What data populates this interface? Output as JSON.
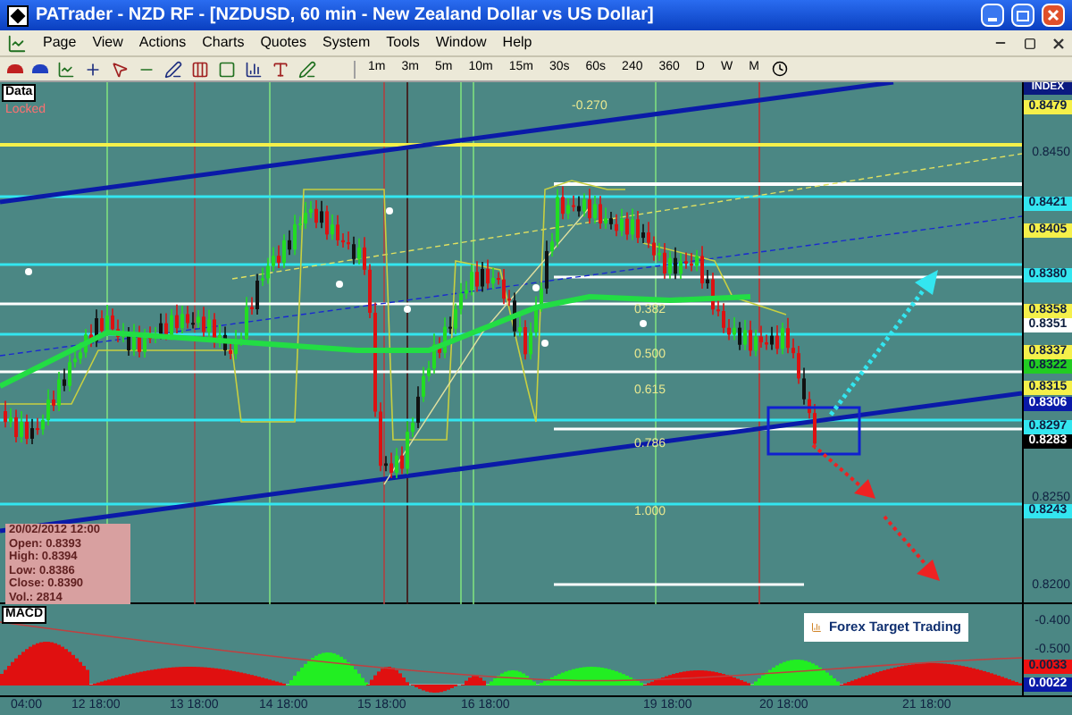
{
  "window": {
    "title": "PATrader - NZD RF - [NZDUSD, 60 min - New Zealand Dollar vs US Dollar]"
  },
  "menu": [
    "Page",
    "View",
    "Actions",
    "Charts",
    "Quotes",
    "System",
    "Tools",
    "Window",
    "Help"
  ],
  "timeframes": [
    "1m",
    "3m",
    "5m",
    "10m",
    "15m",
    "30s",
    "60s",
    "240",
    "360",
    "D",
    "W",
    "M"
  ],
  "chart": {
    "panel_label": "Data",
    "status": "Locked",
    "axis_header": "INDEX",
    "price_labels": [
      {
        "text": "0.8479",
        "kind": "tag",
        "color": "#f5f04a"
      },
      {
        "text": "0.8450",
        "kind": "tick"
      },
      {
        "text": "0.8421",
        "kind": "tag",
        "color": "#33e6f0"
      },
      {
        "text": "0.8405",
        "kind": "tag",
        "color": "#f5f04a"
      },
      {
        "text": "0.8380",
        "kind": "tag",
        "color": "#33e6f0"
      },
      {
        "text": "0.8358",
        "kind": "tag",
        "color": "#f5f04a"
      },
      {
        "text": "0.8351",
        "kind": "tag",
        "color": "#ffffff"
      },
      {
        "text": "0.8337",
        "kind": "tag",
        "color": "#f5f04a"
      },
      {
        "text": "0.8322",
        "kind": "tag",
        "color": "#22cc22"
      },
      {
        "text": "0.8315",
        "kind": "tag",
        "color": "#f5f04a"
      },
      {
        "text": "0.8306",
        "kind": "tag",
        "color": "#0a1aa8"
      },
      {
        "text": "0.8297",
        "kind": "tag",
        "color": "#33e6f0"
      },
      {
        "text": "0.8283",
        "kind": "tag",
        "color": "#000000"
      },
      {
        "text": "0.8250",
        "kind": "tick"
      },
      {
        "text": "0.8243",
        "kind": "tag",
        "color": "#33e6f0"
      },
      {
        "text": "0.8200",
        "kind": "tick"
      }
    ],
    "fib_levels": [
      "-0.270",
      "0.382",
      "0.500",
      "0.615",
      "0.786",
      "1.000"
    ],
    "info_box": {
      "datetime": "20/02/2012 12:00",
      "lines": [
        "Open: 0.8393",
        "High: 0.8394",
        "Low: 0.8386",
        "Close: 0.8390",
        "Vol.: 2814"
      ]
    },
    "logo": "Forex Target Trading"
  },
  "macd": {
    "label": "MACD",
    "axis_labels": [
      {
        "text": "-0.400",
        "kind": "tick"
      },
      {
        "text": "-0.500",
        "kind": "tick"
      },
      {
        "text": "0.0033",
        "kind": "tag",
        "color": "#ee1111"
      },
      {
        "text": "0.0022",
        "kind": "tag",
        "color": "#0a1aa8"
      }
    ]
  },
  "time_axis": [
    "04:00",
    "12 18:00",
    "13 18:00",
    "14 18:00",
    "15 18:00",
    "16 18:00",
    "19 18:00",
    "20 18:00",
    "21 18:00"
  ]
}
